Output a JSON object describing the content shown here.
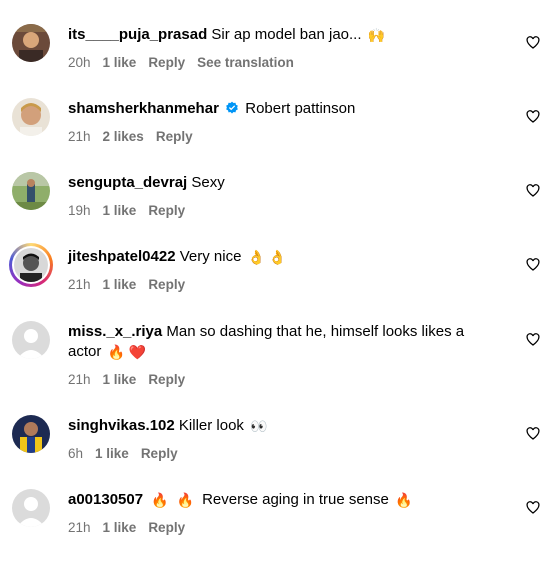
{
  "comments": [
    {
      "username": "its____puja_prasad",
      "text": "Sir ap model ban jao...",
      "emoji": "🙌",
      "time": "20h",
      "likes": "1 like",
      "reply": "Reply",
      "extra": "See translation"
    },
    {
      "username": "shamsherkhanmehar",
      "text": "Robert pattinson",
      "time": "21h",
      "likes": "2 likes",
      "reply": "Reply"
    },
    {
      "username": "sengupta_devraj",
      "text": "Sexy",
      "time": "19h",
      "likes": "1 like",
      "reply": "Reply"
    },
    {
      "username": "jiteshpatel0422",
      "text": "Very nice",
      "emoji": "👌 👌",
      "time": "21h",
      "likes": "1 like",
      "reply": "Reply"
    },
    {
      "username": "miss._x_.riya",
      "text": "Man so dashing that he, himself looks likes a",
      "text2": "actor",
      "emoji": "🔥 ❤️",
      "time": "21h",
      "likes": "1 like",
      "reply": "Reply"
    },
    {
      "username": "singhvikas.102",
      "text": "Killer look",
      "emoji": "👀",
      "time": "6h",
      "likes": "1 like",
      "reply": "Reply"
    },
    {
      "username": "a00130507",
      "emoji_pre": "🔥  🔥",
      "text": "Reverse aging in true sense",
      "emoji": "🔥",
      "time": "21h",
      "likes": "1 like",
      "reply": "Reply"
    }
  ],
  "icons": {
    "like": "heart-icon",
    "verified": "verified-badge-icon",
    "default_avatar": "default-avatar-icon"
  },
  "colors": {
    "meta": "#737373",
    "verified": "#0095f6"
  }
}
